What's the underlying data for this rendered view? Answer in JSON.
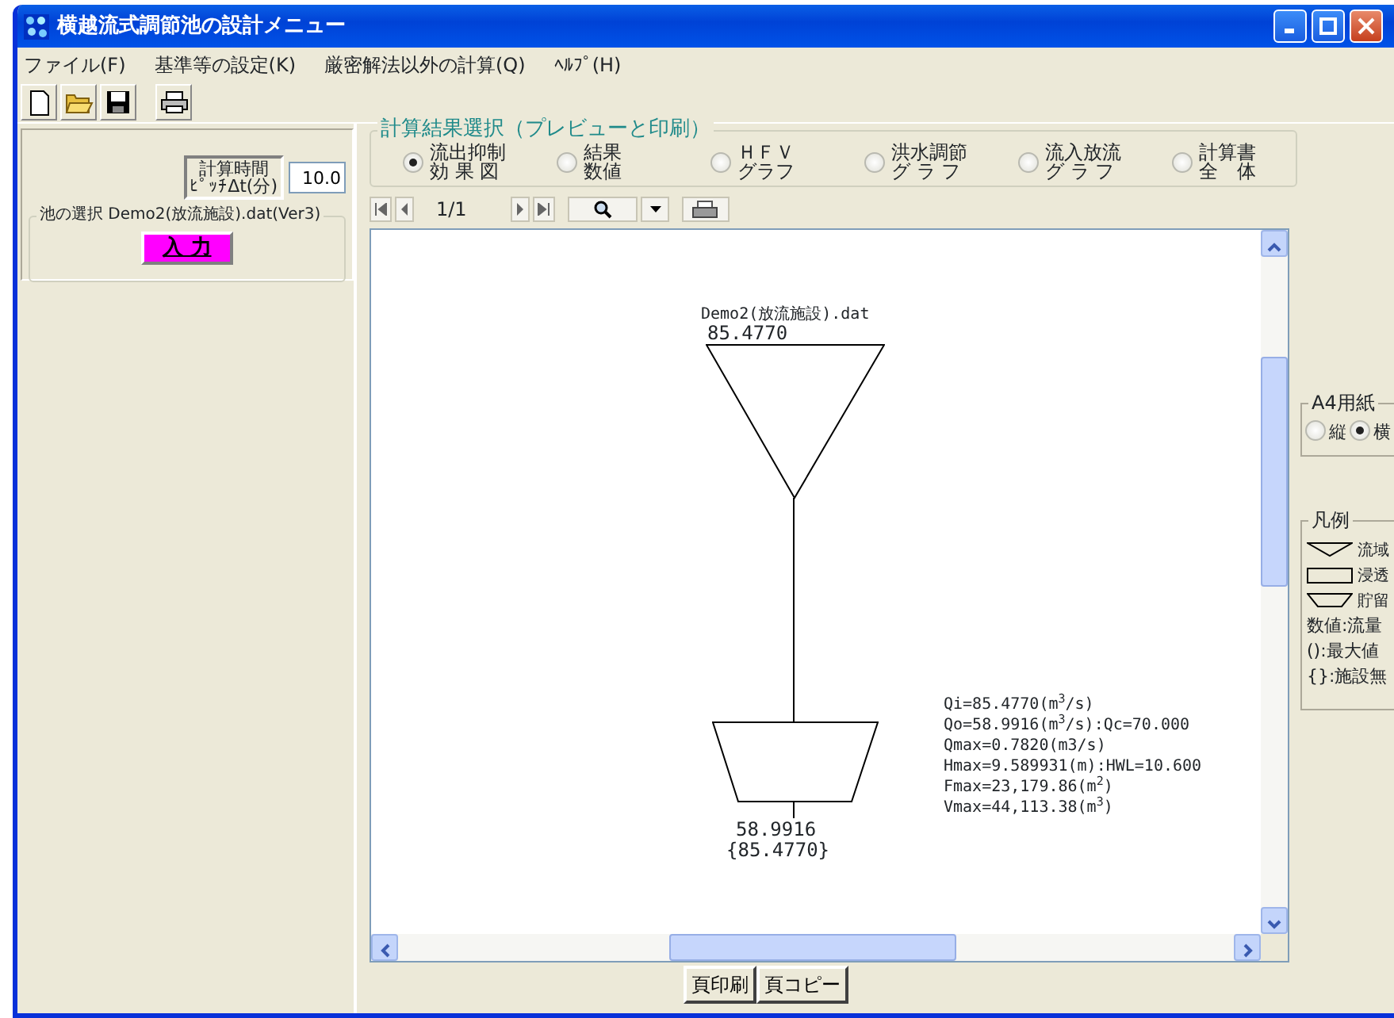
{
  "window": {
    "title": "横越流式調節池の設計メニュー"
  },
  "menu": [
    {
      "label": "ファイル(F)"
    },
    {
      "label": "基準等の設定(K)"
    },
    {
      "label": "厳密解法以外の計算(Q)"
    },
    {
      "label": "ﾍﾙﾌﾟ(H)"
    }
  ],
  "time_pitch": {
    "label_lines": [
      "計算時間",
      "ﾋﾟｯﾁΔt(分)"
    ],
    "value": "10.0"
  },
  "pond_selection": {
    "title": "池の選択 Demo2(放流施設).dat(Ver3)",
    "button": "入 力"
  },
  "result_selection": {
    "title": "計算結果選択（プレビューと印刷）",
    "options": [
      {
        "lines": [
          "流出抑制",
          "効 果 図"
        ],
        "selected": true
      },
      {
        "lines": [
          "結果",
          "数値"
        ],
        "selected": false
      },
      {
        "lines": [
          "ＨＦＶ",
          "グラフ"
        ],
        "selected": false
      },
      {
        "lines": [
          "洪水調節",
          "グ ラ フ"
        ],
        "selected": false
      },
      {
        "lines": [
          "流入放流",
          "グ ラ フ"
        ],
        "selected": false
      },
      {
        "lines": [
          "計算書",
          "全　体"
        ],
        "selected": false
      }
    ]
  },
  "preview_nav": {
    "page": "1/1"
  },
  "diagram": {
    "file": "Demo2(放流施設).dat",
    "inflow": "85.4770",
    "outflow": "58.9916",
    "no_facility": "{85.4770}",
    "stats": [
      "Qi=85.4770(m$^{3}$/s)",
      "Qo=58.9916(m$^{3}$/s):Qc=70.000",
      "Qmax=0.7820(m3/s)",
      "Hmax=9.589931(m):HWL=10.600",
      "Fmax=23,179.86(m$^{2}$)",
      "Vmax=44,113.38(m$^{3}$)"
    ]
  },
  "paper": {
    "title": "A4用紙",
    "options": [
      {
        "label": "縦",
        "selected": false
      },
      {
        "label": "横",
        "selected": true
      }
    ]
  },
  "legend": {
    "title": "凡例",
    "items": [
      {
        "kind": "triangle",
        "label": "流域"
      },
      {
        "kind": "rectangle",
        "label": "浸透"
      },
      {
        "kind": "trapezoid",
        "label": "貯留"
      },
      {
        "kind": "text",
        "label": "数値:流量"
      },
      {
        "kind": "text",
        "label": "():最大値"
      },
      {
        "kind": "text",
        "label": "{}:施設無"
      }
    ]
  },
  "buttons": [
    "頁印刷",
    "頁コピー"
  ]
}
